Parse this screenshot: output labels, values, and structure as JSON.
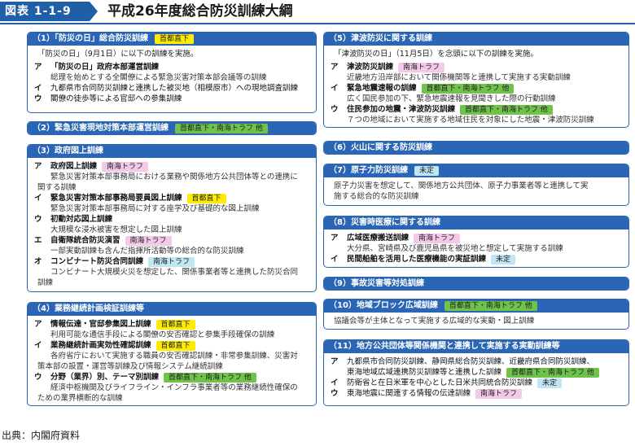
{
  "figure": {
    "label": "図表 1-1-9",
    "title": "平成26年度総合防災訓練大綱"
  },
  "tags": {
    "yellow": "#ffec00",
    "green": "#6fc24a",
    "pink": "#f4c9e8",
    "blue": "#bfe6f3"
  },
  "panels": {
    "p1": {
      "title": "（1）「防災の日」総合防災訓練",
      "tag": "首都直下",
      "intro": "「防災の日」（9月1日）に以下の訓練を実施。",
      "items": [
        {
          "k": "ア",
          "label": "「防災の日」政府本部運営訓練",
          "sub": [
            "総理を始めとする全閣僚による緊急災害対策本部会議等の訓練"
          ]
        },
        {
          "k": "イ",
          "label": "九都県市合同防災訓練と連携した被災地（相模原市）への現地調査訓練"
        },
        {
          "k": "ウ",
          "label": "閣僚の徒歩等による官邸への参集訓練"
        }
      ]
    },
    "p2": {
      "title": "（2）緊急災害現地対策本部運営訓練",
      "tag": "首都直下・南海トラフ 他"
    },
    "p3": {
      "title": "（3）政府図上訓練",
      "items": [
        {
          "k": "ア",
          "label": "政府図上訓練",
          "tag": "南海トラフ",
          "sub": [
            "緊急災害対策本部事務局における業務や関係地方公共団体等との連携に",
            "関する訓練"
          ]
        },
        {
          "k": "イ",
          "label": "緊急災害対策本部事務局要員図上訓練",
          "tag": "首都直下",
          "sub": [
            "緊急災害対策本部事務局に対する座学及び基礎的な図上訓練"
          ]
        },
        {
          "k": "ウ",
          "label": "初動対応図上訓練",
          "sub": [
            "大規模な浸水被害を想定した図上訓練"
          ]
        },
        {
          "k": "エ",
          "label": "自衛隊統合防災演習",
          "tag": "南海トラフ",
          "sub": [
            "一部実動訓練も含んだ指揮所活動等の総合的な防災訓練"
          ]
        },
        {
          "k": "オ",
          "label": "コンビナート防災合同訓練",
          "tag": "南海トラフ",
          "sub": [
            "コンビナート大規模火災を想定した、関係事業者等と連携した防災合同",
            "訓練"
          ]
        }
      ]
    },
    "p4": {
      "title": "（4）業務継続計画検証訓練等",
      "items": [
        {
          "k": "ア",
          "label": "情報伝達・官邸参集図上訓練",
          "tag": "首都直下",
          "sub": [
            "利用可能な通信手段による閣僚の安否確認と参集手段確保の訓練"
          ]
        },
        {
          "k": "イ",
          "label": "業務継続計画実効性確認訓練",
          "tag": "首都直下",
          "sub": [
            "各府省庁において実施する職員の安否確認訓練・非常参集訓練、災害対",
            "策本部の設置・運営等訓練及び情報システム継続訓練"
          ]
        },
        {
          "k": "ウ",
          "label": "分野（業界）別、テーマ別訓練",
          "tag": "首都直下・南海トラフ 他",
          "sub": [
            "経済中枢機関及びライフライン・インフラ事業者等の業務継続性確保の",
            "ための業界横断的な訓練"
          ]
        }
      ]
    },
    "p5": {
      "title": "（5）津波防災に関する訓練",
      "intro": "「津波防災の日」（11月5日）を念頭に以下の訓練を実施。",
      "items": [
        {
          "k": "ア",
          "label": "津波防災訓練",
          "tag": "南海トラフ",
          "sub": [
            "近畿地方沿岸部において関係機関等と連携して実施する実動訓練"
          ]
        },
        {
          "k": "イ",
          "label": "緊急地震速報の訓練",
          "tag": "首都直下・南海トラフ 他",
          "sub": [
            "広く国民参加の下、緊急地震速報を見聞きした際の行動訓練"
          ]
        },
        {
          "k": "ウ",
          "label": "住民参加の地震・津波防災訓練",
          "tag": "首都直下・南海トラフ 他",
          "sub": [
            "７つの地域において実施する地域住民を対象にした地震・津波防災訓練"
          ]
        }
      ]
    },
    "p6": {
      "title": "（6）火山に関する防災訓練"
    },
    "p7": {
      "title": "（7）原子力防災訓練",
      "tag": "未定",
      "lines": [
        "原子力災害を想定して、関係地方公共団体、原子力事業者等と連携して実",
        "施する総合的な防災訓練"
      ]
    },
    "p8": {
      "title": "（8）災害時医療に関する訓練",
      "items": [
        {
          "k": "ア",
          "label": "広域医療搬送訓練",
          "tag": "南海トラフ",
          "sub": [
            "大分県、宮崎県及び鹿児島県を被災地と想定して実施する訓練"
          ]
        },
        {
          "k": "イ",
          "label": "民間船舶を活用した医療機能の実証訓練",
          "tag": "未定"
        }
      ]
    },
    "p9": {
      "title": "（9）事故災害等対処訓練"
    },
    "p10": {
      "title": "（10）地域ブロック広域訓練",
      "tag": "首都直下・南海トラフ 他",
      "lines": [
        "協議会等が主体となって実施する広域的な実動・図上訓練"
      ]
    },
    "p11": {
      "title": "（11）地方公共団体等関係機関と連携して実施する実動訓練等",
      "items": [
        {
          "k": "ア",
          "label": "九都県市合同防災訓練、静岡県総合防災訓練、近畿府県合同防災訓練、"
        },
        {
          "k": "",
          "label": "東海地域広域連携防災訓練等と連携した訓練",
          "tag": "首都直下・南海トラフ 他"
        },
        {
          "k": "イ",
          "label": "防衛省と在日米軍を中心とした日米共同統合防災訓練",
          "tag": "未定"
        },
        {
          "k": "ウ",
          "label": "東海地震に関連する情報の伝達訓練",
          "tag": "南海トラフ"
        }
      ]
    }
  },
  "source": "出典：内閣府資料"
}
